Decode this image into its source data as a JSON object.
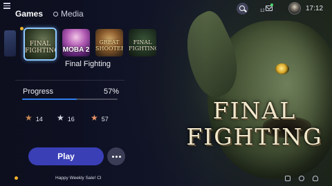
{
  "nav": {
    "tab_games": "Games",
    "tab_media": "Media"
  },
  "status_bar": {
    "notification_count": "12",
    "time": "17:12"
  },
  "library": {
    "tiles": [
      {
        "label": "FINAL FIGHTING",
        "selected": true
      },
      {
        "label": "MOBA 2",
        "selected": false
      },
      {
        "label": "GREAT SHOOTER",
        "selected": false
      },
      {
        "label": "FINAL FIGHTING",
        "selected": false
      }
    ],
    "selected_name": "Final Fighting"
  },
  "hero": {
    "title_line1": "FINAL",
    "title_line2": "FIGHTING"
  },
  "progress": {
    "label": "Progress",
    "value_text": "57%",
    "fraction": 0.57
  },
  "trophies": {
    "bronze": "14",
    "silver": "16",
    "gold": "57"
  },
  "actions": {
    "play_label": "Play"
  },
  "news": {
    "ticker": "Happy Weekly Sale! Chec"
  },
  "colors": {
    "accent": "#3a3fb6",
    "progress": "#2f7ff0",
    "selected_outline": "#8ec7ff",
    "notification_dot": "#49d96b",
    "indicator_dot": "#f3b229"
  }
}
